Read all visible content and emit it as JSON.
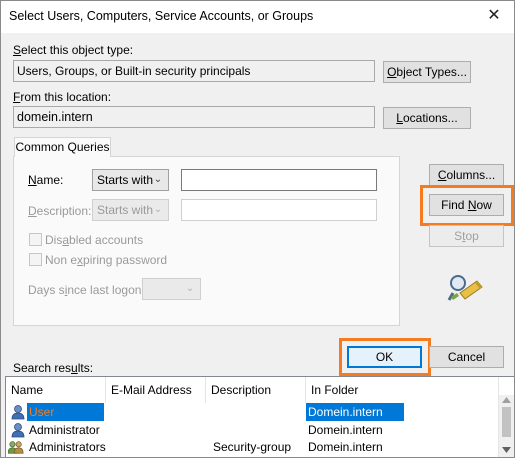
{
  "window": {
    "title": "Select Users, Computers, Service Accounts, or Groups",
    "close_glyph": "✕"
  },
  "object_type": {
    "label": "Select this object type:",
    "value": "Users, Groups, or Built-in security principals",
    "button": "Object Types..."
  },
  "location": {
    "label": "From this location:",
    "value": "domein.intern",
    "button": "Locations..."
  },
  "queries": {
    "tab": "Common Queries",
    "name_label": "Name:",
    "name_mode": "Starts with",
    "name_value": "",
    "description_label": "Description:",
    "description_mode": "Starts with",
    "description_value": "",
    "disabled_accounts": "Disabled accounts",
    "non_expiring": "Non expiring password",
    "days_label": "Days since last logon:",
    "days_value": ""
  },
  "side_buttons": {
    "columns": "Columns...",
    "find_now": "Find Now",
    "stop": "Stop"
  },
  "footer": {
    "search_results": "Search results:",
    "ok": "OK",
    "cancel": "Cancel"
  },
  "results": {
    "columns": [
      "Name",
      "E-Mail Address",
      "Description",
      "In Folder"
    ],
    "rows": [
      {
        "name": "User",
        "email": "",
        "description": "",
        "folder": "Domein.intern",
        "icon": "user-icon",
        "selected": true
      },
      {
        "name": "Administrator",
        "email": "",
        "description": "",
        "folder": "Domein.intern",
        "icon": "user-icon",
        "selected": false
      },
      {
        "name": "Administrators",
        "email": "",
        "description": "Security-group",
        "folder": "Domein.intern",
        "icon": "group-icon",
        "selected": false
      }
    ]
  },
  "colors": {
    "highlight": "#f47b20",
    "selection": "#0078d7"
  }
}
